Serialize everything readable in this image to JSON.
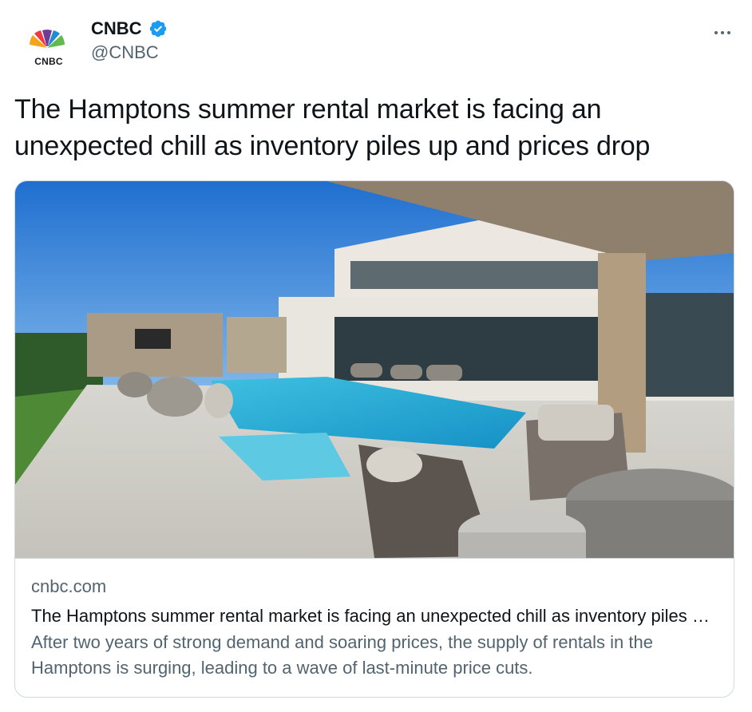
{
  "account": {
    "display_name": "CNBC",
    "handle": "@CNBC",
    "verified": true,
    "avatar_text": "CNBC",
    "verified_color": "#1d9bf0"
  },
  "tweet": {
    "text": "The Hamptons summer rental market is facing an unexpected chill as inventory piles up and prices drop"
  },
  "card": {
    "domain": "cnbc.com",
    "title": "The Hamptons summer rental market is facing an unexpected chill as inventory piles up and prices drop",
    "description": "After two years of strong demand and soaring prices, the supply of rentals in the Hamptons is surging, leading to a wave of last-minute price cuts.",
    "image_subject": "luxury-home-with-pool"
  },
  "icons": {
    "more": "more-options-icon",
    "verified": "verified-badge-icon"
  }
}
